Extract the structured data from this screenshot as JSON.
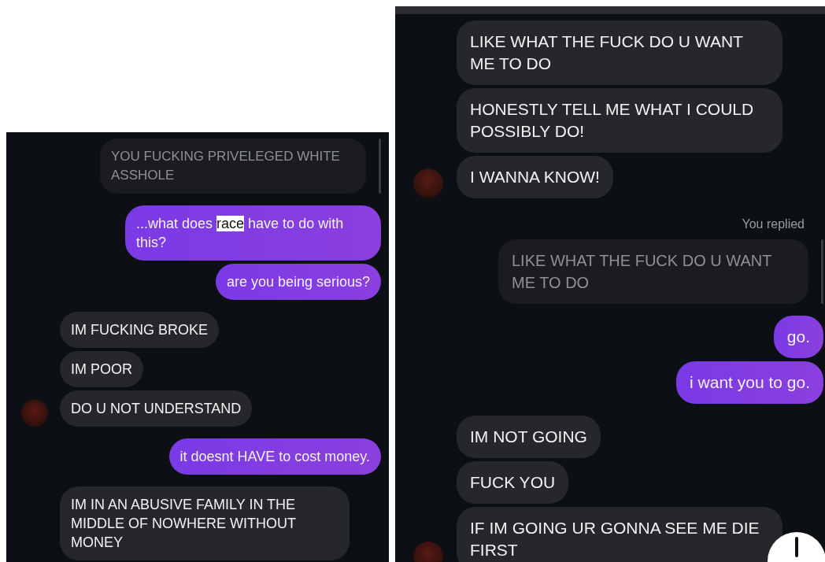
{
  "panels": [
    {
      "scroll_button": false,
      "messages": [
        {
          "kind": "quoted",
          "text": "YOU FUCKING PRIVELEGED WHITE ASSHOLE"
        },
        {
          "kind": "outgoing",
          "segments": [
            {
              "text": "...what does ",
              "highlighted": false
            },
            {
              "text": "race",
              "highlighted": true
            },
            {
              "text": " have to do with this?",
              "highlighted": false
            }
          ]
        },
        {
          "kind": "outgoing",
          "text": "are you being serious?"
        },
        {
          "kind": "incoming",
          "text": "IM FUCKING BROKE",
          "avatar": false
        },
        {
          "kind": "incoming",
          "text": "IM POOR",
          "avatar": false
        },
        {
          "kind": "incoming",
          "text": "DO U NOT UNDERSTAND",
          "avatar": true
        },
        {
          "kind": "outgoing",
          "text": "it doesnt HAVE to cost money."
        },
        {
          "kind": "incoming",
          "text": "IM IN AN ABUSIVE FAMILY IN THE MIDDLE OF NOWHERE WITHOUT MONEY",
          "avatar": false
        }
      ]
    },
    {
      "scroll_button": true,
      "messages": [
        {
          "kind": "incoming",
          "text": "LIKE WHAT THE FUCK DO U WANT ME TO DO",
          "avatar": false
        },
        {
          "kind": "incoming",
          "text": "HONESTLY TELL ME WHAT I COULD POSSIBLY DO!",
          "avatar": false
        },
        {
          "kind": "incoming",
          "text": "I WANNA KNOW!",
          "avatar": true
        },
        {
          "kind": "status",
          "text": "You replied"
        },
        {
          "kind": "quoted",
          "text": "LIKE WHAT THE FUCK DO U WANT ME TO DO"
        },
        {
          "kind": "outgoing",
          "text": "go."
        },
        {
          "kind": "outgoing",
          "text": "i want you to go."
        },
        {
          "kind": "incoming",
          "text": "IM NOT GOING",
          "avatar": false
        },
        {
          "kind": "incoming",
          "text": "FUCK YOU",
          "avatar": false
        },
        {
          "kind": "incoming",
          "text": "IF IM GOING UR GONNA SEE ME DIE FIRST",
          "avatar": true
        }
      ]
    }
  ]
}
